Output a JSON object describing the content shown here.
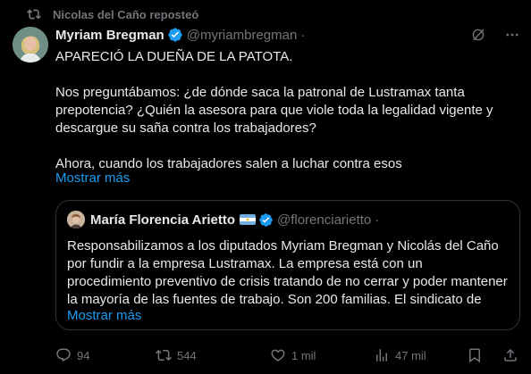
{
  "repost": {
    "text": "Nicolas del Caño reposteó"
  },
  "tweet": {
    "author_name": "Myriam Bregman",
    "author_handle": "@myriambregman",
    "dot": "·",
    "text": "APARECIÓ LA DUEÑA DE LA PATOTA.\n\nNos preguntábamos: ¿de dónde saca la patronal de Lustramax tanta prepotencia? ¿Quién la asesora para que viole toda la legalidad vigente y descargue su saña contra los trabajadores?\n\nAhora, cuando los trabajadores salen a luchar contra esos",
    "show_more": "Mostrar más"
  },
  "quote": {
    "author_name": "María Florencia Arietto",
    "author_handle": "@florenciarietto",
    "dot": "·",
    "text": "Responsabilizamos a los diputados Myriam Bregman y Nicolás del Caño por fundir a la empresa Lustramax. La empresa está con un procedimiento preventivo de crisis tratando de no cerrar y poder mantener la mayoría de las fuentes de trabajo. Son 200 familias. El sindicato de",
    "show_more": "Mostrar más"
  },
  "actions": {
    "replies": "94",
    "reposts": "544",
    "likes": "1 mil",
    "views": "47 mil"
  },
  "icons": {
    "repost": "repost-icon",
    "verified": "verified-badge-icon",
    "grok": "grok-icon",
    "more": "more-icon",
    "reply": "reply-icon",
    "like": "like-icon",
    "views": "views-icon",
    "bookmark": "bookmark-icon",
    "share": "share-icon"
  },
  "colors": {
    "background": "#000000",
    "text": "#e7e9ea",
    "muted": "#71767b",
    "link": "#1d9bf0",
    "verified": "#1d9bf0",
    "border": "#2f3336"
  }
}
